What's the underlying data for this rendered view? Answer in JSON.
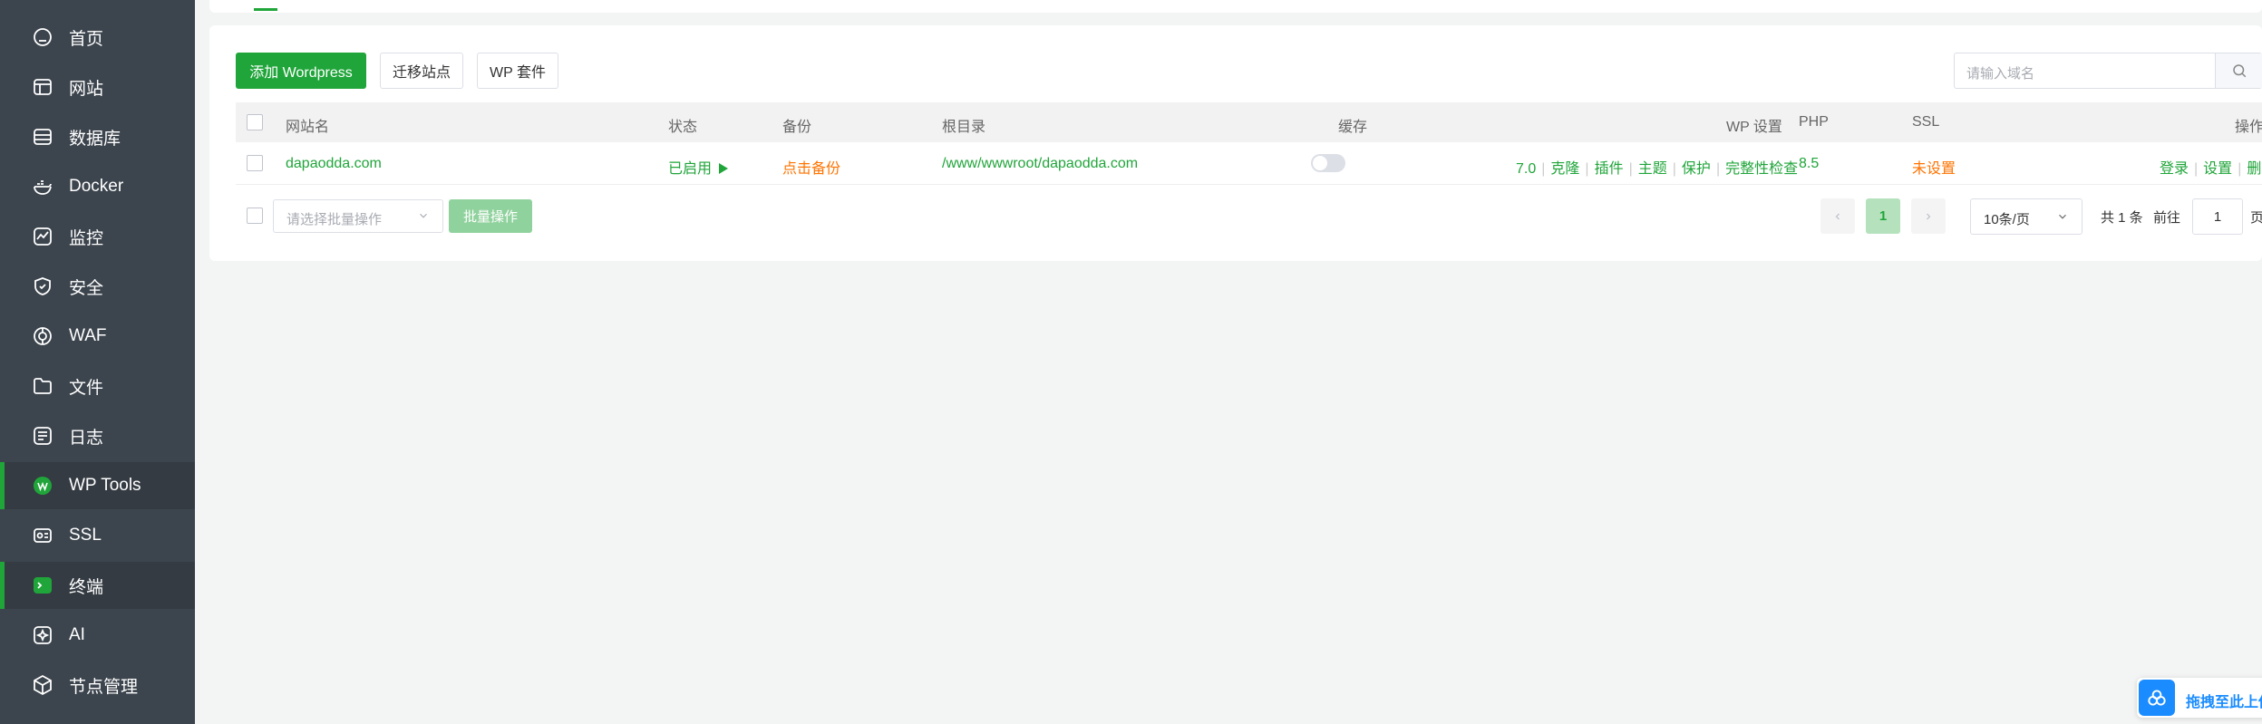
{
  "sidebar": {
    "items": [
      {
        "label": "首页",
        "icon": "home-icon"
      },
      {
        "label": "网站",
        "icon": "website-icon"
      },
      {
        "label": "数据库",
        "icon": "database-icon"
      },
      {
        "label": "Docker",
        "icon": "docker-icon"
      },
      {
        "label": "监控",
        "icon": "monitor-icon"
      },
      {
        "label": "安全",
        "icon": "shield-icon"
      },
      {
        "label": "WAF",
        "icon": "waf-icon"
      },
      {
        "label": "文件",
        "icon": "folder-icon"
      },
      {
        "label": "日志",
        "icon": "log-icon"
      },
      {
        "label": "WP Tools",
        "icon": "wordpress-icon",
        "active": true
      },
      {
        "label": "SSL",
        "icon": "ssl-icon"
      },
      {
        "label": "终端",
        "icon": "terminal-icon",
        "active": true
      },
      {
        "label": "AI",
        "icon": "ai-icon"
      },
      {
        "label": "节点管理",
        "icon": "node-icon"
      }
    ]
  },
  "toolbar": {
    "add_label": "添加 Wordpress",
    "migrate_label": "迁移站点",
    "suite_label": "WP 套件",
    "search_placeholder": "请输入域名"
  },
  "table": {
    "headers": {
      "name": "网站名",
      "status": "状态",
      "backup": "备份",
      "root": "根目录",
      "cache": "缓存",
      "wp_settings": "WP 设置",
      "php": "PHP",
      "ssl": "SSL",
      "actions": "操作"
    },
    "rows": [
      {
        "name": "dapaodda.com",
        "status": "已启用",
        "status_icon": "play-icon",
        "backup": "点击备份",
        "root": "/www/wwwroot/dapaodda.com",
        "cache_enabled": false,
        "wp_version": "7.0",
        "wp_clone": "克隆",
        "wp_plugins": "插件",
        "wp_themes": "主题",
        "wp_protect": "保护",
        "wp_integrity": "完整性检查",
        "php": "8.5",
        "ssl": "未设置",
        "act_login": "登录",
        "act_settings": "设置",
        "act_delete": "删除"
      }
    ]
  },
  "batch": {
    "placeholder": "请选择批量操作",
    "button": "批量操作"
  },
  "pagination": {
    "current_page": "1",
    "page_size": "10条/页",
    "total": "共 1 条",
    "goto_label": "前往",
    "goto_value": "1",
    "page_suffix": "页"
  },
  "upload": {
    "label": "拖拽至此上传"
  },
  "colors": {
    "accent": "#20a53a",
    "warning": "#ff7300",
    "sidebar_bg": "#3c444d"
  }
}
